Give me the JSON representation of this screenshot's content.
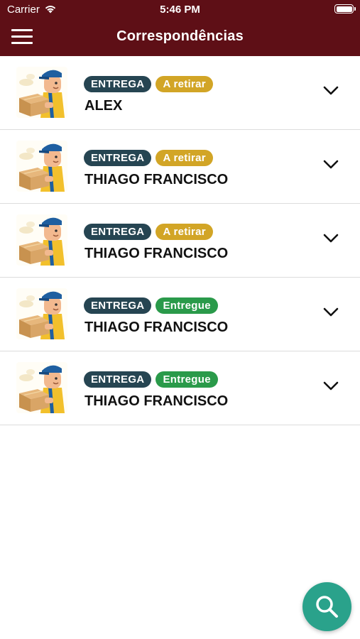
{
  "status_bar": {
    "carrier": "Carrier",
    "time": "5:46 PM"
  },
  "header": {
    "title": "Correspondências"
  },
  "colors": {
    "header": "#5e0f16",
    "type_badge": "#264552",
    "a_retirar": "#d2a526",
    "entregue": "#2a9a4a",
    "fab": "#2aa28b"
  },
  "items": [
    {
      "type": "ENTREGA",
      "status": "A retirar",
      "status_color": "#d2a526",
      "name": "ALEX"
    },
    {
      "type": "ENTREGA",
      "status": "A retirar",
      "status_color": "#d2a526",
      "name": "THIAGO FRANCISCO"
    },
    {
      "type": "ENTREGA",
      "status": "A retirar",
      "status_color": "#d2a526",
      "name": "THIAGO FRANCISCO"
    },
    {
      "type": "ENTREGA",
      "status": "Entregue",
      "status_color": "#2a9a4a",
      "name": "THIAGO FRANCISCO"
    },
    {
      "type": "ENTREGA",
      "status": "Entregue",
      "status_color": "#2a9a4a",
      "name": "THIAGO FRANCISCO"
    }
  ],
  "icons": {
    "menu": "hamburger-menu-icon",
    "avatar": "delivery-man-icon",
    "expand": "chevron-down-icon",
    "fab": "search-icon"
  }
}
